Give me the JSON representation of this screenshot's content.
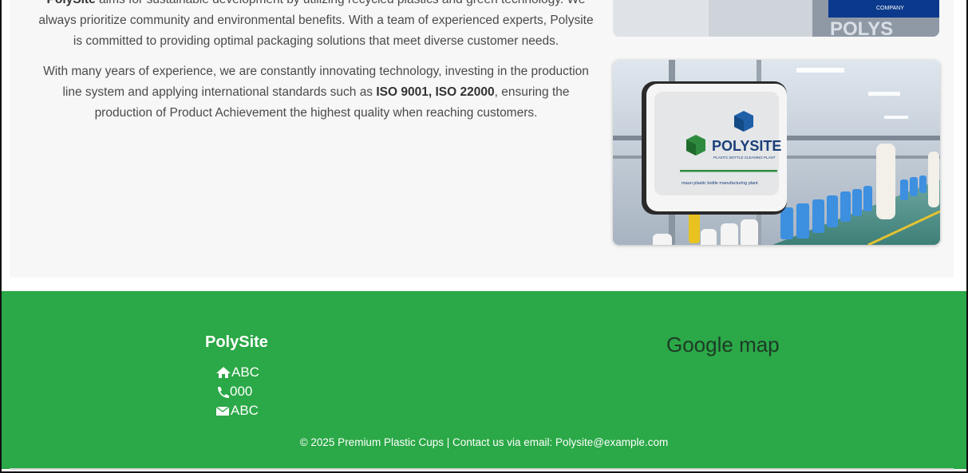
{
  "about": {
    "p1_bold": "PolySite",
    "p1_line1_rest": " aims for sustainable development by utilizing recycled plastics and green technology. We",
    "p1_line2": "always prioritize community and environmental benefits. With a team of experienced experts, Polysite",
    "p1_line3": "is committed to providing optimal packaging solutions that meet diverse customer needs.",
    "p2_line1": "With many years of experience, we are constantly innovating technology, investing in the production",
    "p2_line2_pre": "line system and applying international standards such as ",
    "p2_line2_bold": "ISO 9001, ISO 22000",
    "p2_line2_post": ", ensuring the",
    "p2_line3": "production of Product Achievement the highest quality when reaching customers."
  },
  "images": {
    "top_sign_text": "POLYS",
    "top_banner_text": "COMPANY",
    "main_sign_brand": "POLYSITE",
    "main_sign_tagline": "PLASTIC BOTTLE CLEANING PLANT",
    "main_sign_caption": "maun plastic bottle manufacturing plant"
  },
  "footer": {
    "brand": "PolySite",
    "address": "ABC",
    "phone": "000",
    "email": "ABC",
    "map_label": "Google map",
    "copyright": "© 2025 Premium Plastic Cups | Contact us via email: Polysite@example.com"
  },
  "colors": {
    "footer_bg": "#2ba847",
    "about_bg": "#f7f7f7",
    "map_text": "#1d3a26"
  }
}
